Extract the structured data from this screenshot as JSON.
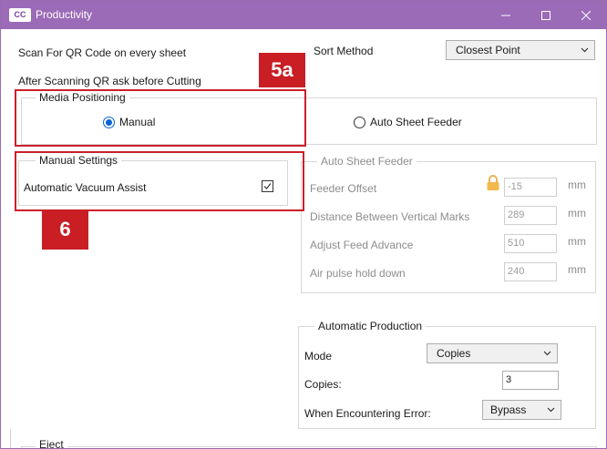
{
  "window": {
    "icon_text": "CC",
    "title": "Productivity"
  },
  "options": {
    "scan_qr": "Scan For QR Code on every sheet",
    "ask_before_cutting": "After Scanning QR ask before Cutting",
    "sort_method_label": "Sort Method",
    "sort_method_value": "Closest Point"
  },
  "media_positioning": {
    "title": "Media Positioning",
    "manual": "Manual",
    "auto_sheet_feeder": "Auto Sheet Feeder",
    "selected": "Manual"
  },
  "manual_settings": {
    "title": "Manual Settings",
    "vacuum_label": "Automatic Vacuum Assist",
    "vacuum_checked": true
  },
  "auto_sheet_feeder": {
    "title": "Auto Sheet Feeder",
    "rows": [
      {
        "label": "Feeder Offset",
        "value": "-15",
        "unit": "mm"
      },
      {
        "label": "Distance Between Vertical Marks",
        "value": "289",
        "unit": "mm"
      },
      {
        "label": "Adjust Feed Advance",
        "value": "510",
        "unit": "mm"
      },
      {
        "label": "Air pulse hold down",
        "value": "240",
        "unit": "mm"
      }
    ]
  },
  "automatic_production": {
    "title": "Automatic Production",
    "mode_label": "Mode",
    "mode_value": "Copies",
    "copies_label": "Copies:",
    "copies_value": "3",
    "error_label": "When Encountering Error:",
    "error_value": "Bypass"
  },
  "eject": {
    "title": "Eject"
  },
  "badges": {
    "b5a": "5a",
    "b6": "6"
  },
  "colors": {
    "titlebar": "#9b6bb8",
    "accent": "#0a64d8",
    "callout": "#c81e24"
  }
}
